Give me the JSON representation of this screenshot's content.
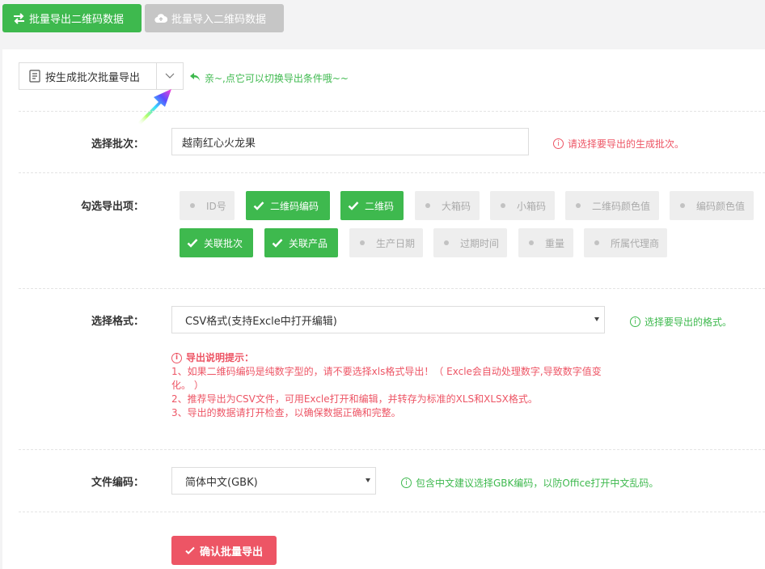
{
  "toolbar": {
    "export_label": "批量导出二维码数据",
    "import_label": "批量导入二维码数据"
  },
  "export_mode": {
    "selected": "按生成批次批量导出",
    "tip": "亲~,点它可以切换导出条件哦~~"
  },
  "batch": {
    "label": "选择批次：",
    "value": "越南红心火龙果",
    "hint": "请选择要导出的生成批次。"
  },
  "fields": {
    "label": "勾选导出项：",
    "row1": [
      {
        "label": "ID号",
        "checked": false
      },
      {
        "label": "二维码编码",
        "checked": true
      },
      {
        "label": "二维码",
        "checked": true
      },
      {
        "label": "大箱码",
        "checked": false
      },
      {
        "label": "小箱码",
        "checked": false
      },
      {
        "label": "二维码颜色值",
        "checked": false
      },
      {
        "label": "编码颜色值",
        "checked": false
      }
    ],
    "row2": [
      {
        "label": "关联批次",
        "checked": true
      },
      {
        "label": "关联产品",
        "checked": true
      },
      {
        "label": "生产日期",
        "checked": false
      },
      {
        "label": "过期时间",
        "checked": false
      },
      {
        "label": "重量",
        "checked": false
      },
      {
        "label": "所属代理商",
        "checked": false
      }
    ]
  },
  "format": {
    "label": "选择格式：",
    "value": "CSV格式(支持Excle中打开编辑)",
    "hint": "选择要导出的格式。"
  },
  "notes": {
    "title": "导出说明提示：",
    "line1": "1、如果二维码编码是纯数字型的，请不要选择xls格式导出！（ Excle会自动处理数字,导致数字值变化。 ）",
    "line2": "2、推荐导出为CSV文件，可用Excle打开和编辑，并转存为标准的XLS和XLSX格式。",
    "line3": "3、导出的数据请打开检查，以确保数据正确和完整。"
  },
  "encoding": {
    "label": "文件编码：",
    "value": "简体中文(GBK)",
    "hint": "包含中文建议选择GBK编码，以防Office打开中文乱码。"
  },
  "submit_label": "确认批量导出",
  "colors": {
    "green": "#3eb94e",
    "red": "#ed5565",
    "gray": "#c6c6c6"
  }
}
